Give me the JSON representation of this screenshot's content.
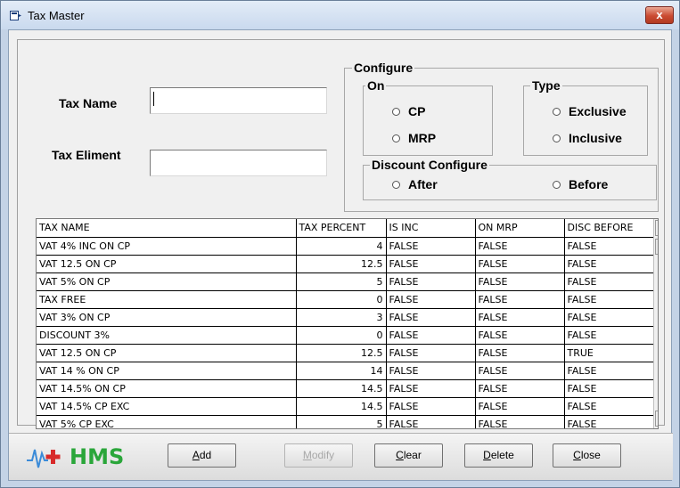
{
  "window": {
    "title": "Tax Master",
    "close_label": "x",
    "icon": "app-icon"
  },
  "form": {
    "tax_name_label": "Tax Name",
    "tax_name_value": "",
    "tax_eliment_label": "Tax Eliment",
    "tax_eliment_value": ""
  },
  "configure": {
    "title": "Configure",
    "on": {
      "title": "On",
      "options": [
        "CP",
        "MRP"
      ]
    },
    "type": {
      "title": "Type",
      "options": [
        "Exclusive",
        "Inclusive"
      ]
    },
    "discount": {
      "title": "Discount Configure",
      "options": [
        "After",
        "Before"
      ]
    }
  },
  "table": {
    "columns": [
      "TAX NAME",
      "TAX PERCENT",
      "IS INC",
      "ON MRP",
      "DISC BEFORE"
    ],
    "rows": [
      [
        "VAT 4% INC ON CP",
        "4",
        "FALSE",
        "FALSE",
        "FALSE"
      ],
      [
        "VAT 12.5 ON CP",
        "12.5",
        "FALSE",
        "FALSE",
        "FALSE"
      ],
      [
        "VAT 5% ON CP",
        "5",
        "FALSE",
        "FALSE",
        "FALSE"
      ],
      [
        "TAX FREE",
        "0",
        "FALSE",
        "FALSE",
        "FALSE"
      ],
      [
        "VAT 3% ON CP",
        "3",
        "FALSE",
        "FALSE",
        "FALSE"
      ],
      [
        "DISCOUNT 3%",
        "0",
        "FALSE",
        "FALSE",
        "FALSE"
      ],
      [
        "VAT 12.5  ON CP",
        "12.5",
        "FALSE",
        "FALSE",
        "TRUE"
      ],
      [
        "VAT 14 % ON CP",
        "14",
        "FALSE",
        "FALSE",
        "FALSE"
      ],
      [
        "VAT 14.5% ON CP",
        "14.5",
        "FALSE",
        "FALSE",
        "FALSE"
      ],
      [
        "VAT 14.5% CP EXC",
        "14.5",
        "FALSE",
        "FALSE",
        "FALSE"
      ],
      [
        "VAT 5% CP EXC",
        "5",
        "FALSE",
        "FALSE",
        "FALSE"
      ]
    ]
  },
  "footer": {
    "logo_text": "HMS",
    "buttons": [
      {
        "label": "Add",
        "mnemonic": "A",
        "rest": "dd",
        "enabled": true
      },
      {
        "label": "Modify",
        "mnemonic": "M",
        "rest": "odify",
        "enabled": false
      },
      {
        "label": "Clear",
        "mnemonic": "C",
        "rest": "lear",
        "enabled": true
      },
      {
        "label": "Delete",
        "mnemonic": "D",
        "rest": "elete",
        "enabled": true
      },
      {
        "label": "Close",
        "mnemonic": "C",
        "rest": "lose",
        "enabled": true
      }
    ]
  },
  "colors": {
    "logo_green": "#2aa63a",
    "logo_red": "#d82a2a",
    "close_red": "#cb4a31"
  }
}
